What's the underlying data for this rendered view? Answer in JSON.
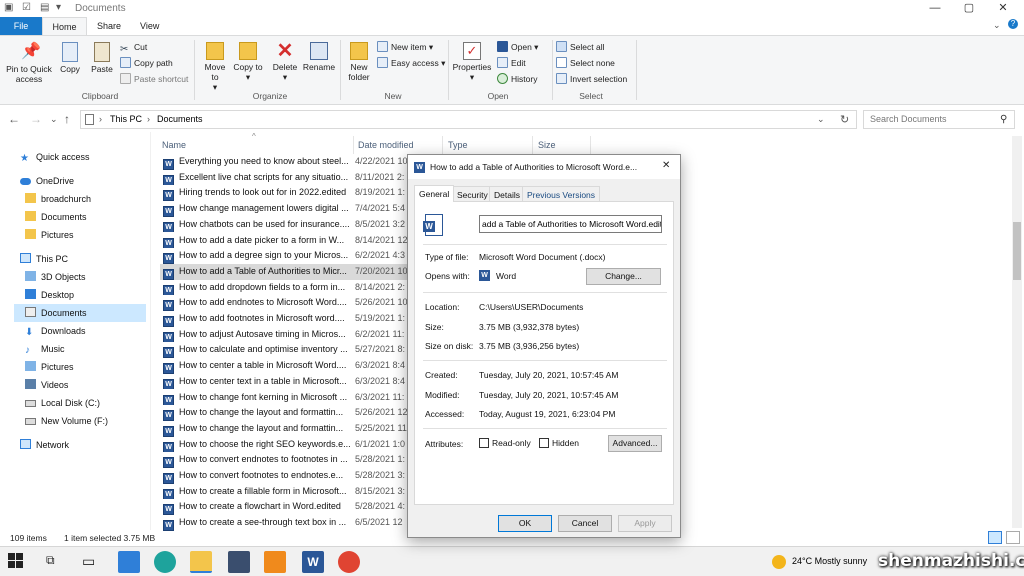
{
  "window": {
    "title": "Documents",
    "controls": {
      "minimize": "—",
      "maximize": "▢",
      "close": "✕"
    }
  },
  "ribbon": {
    "tabs": {
      "file": "File",
      "home": "Home",
      "share": "Share",
      "view": "View"
    },
    "clipboard": {
      "pin": "Pin to Quick access",
      "copy": "Copy",
      "paste": "Paste",
      "cut": "Cut",
      "copy_path": "Copy path",
      "paste_shortcut": "Paste shortcut",
      "label": "Clipboard"
    },
    "organize": {
      "move_to": "Move to",
      "copy_to": "Copy to",
      "delete": "Delete",
      "rename": "Rename",
      "label": "Organize"
    },
    "new": {
      "new_folder": "New folder",
      "new_item": "New item",
      "easy_access": "Easy access",
      "label": "New"
    },
    "open": {
      "properties": "Properties",
      "open": "Open",
      "edit": "Edit",
      "history": "History",
      "label": "Open"
    },
    "select": {
      "select_all": "Select all",
      "select_none": "Select none",
      "invert": "Invert selection",
      "label": "Select"
    }
  },
  "address": {
    "segments": [
      "This PC",
      "Documents"
    ],
    "search_placeholder": "Search Documents"
  },
  "navpane": {
    "quick_access": "Quick access",
    "onedrive": "OneDrive",
    "onedrive_items": [
      "broadchurch",
      "Documents",
      "Pictures"
    ],
    "this_pc": "This PC",
    "this_pc_items": [
      "3D Objects",
      "Desktop",
      "Documents",
      "Downloads",
      "Music",
      "Pictures",
      "Videos",
      "Local Disk (C:)",
      "New Volume (F:)"
    ],
    "network": "Network"
  },
  "columns": {
    "name": "Name",
    "date": "Date modified",
    "type": "Type",
    "size": "Size"
  },
  "files": [
    {
      "name": "Everything you need to know about steel...",
      "date": "4/22/2021 10"
    },
    {
      "name": "Excellent live chat scripts for any situatio...",
      "date": "8/11/2021 2:"
    },
    {
      "name": "Hiring trends to look out for in 2022.edited",
      "date": "8/19/2021 1:"
    },
    {
      "name": "How change management lowers digital ...",
      "date": "7/4/2021 5:4"
    },
    {
      "name": "How chatbots can be used for insurance....",
      "date": "8/5/2021 3:2"
    },
    {
      "name": "How to add a date picker to a form in W...",
      "date": "8/14/2021 12"
    },
    {
      "name": "How to add a degree sign to your Micros...",
      "date": "6/2/2021 4:3"
    },
    {
      "name": "How to add a Table of Authorities to Micr...",
      "date": "7/20/2021 10"
    },
    {
      "name": "How to add dropdown fields to a form in...",
      "date": "8/14/2021 2:"
    },
    {
      "name": "How to add endnotes to Microsoft Word....",
      "date": "5/26/2021 10"
    },
    {
      "name": "How to add footnotes in Microsoft word....",
      "date": "5/19/2021 1:"
    },
    {
      "name": "How to adjust Autosave timing in Micros...",
      "date": "6/2/2021 11:"
    },
    {
      "name": "How to calculate and optimise inventory ...",
      "date": "5/27/2021 8:"
    },
    {
      "name": "How to center a table in Microsoft Word....",
      "date": "6/3/2021 8:4"
    },
    {
      "name": "How to center text in a table in Microsoft...",
      "date": "6/3/2021 8:4"
    },
    {
      "name": "How to change font kerning in Microsoft ...",
      "date": "6/3/2021 11:"
    },
    {
      "name": "How to change the layout and formattin...",
      "date": "5/26/2021 12"
    },
    {
      "name": "How to change the layout and formattin...",
      "date": "5/25/2021 11"
    },
    {
      "name": "How to choose the right SEO keywords.e...",
      "date": "6/1/2021 1:0"
    },
    {
      "name": "How to convert endnotes to footnotes in ...",
      "date": "5/28/2021 1:"
    },
    {
      "name": "How to convert footnotes to endnotes.e...",
      "date": "5/28/2021 3:"
    },
    {
      "name": "How to create a fillable form in Microsoft...",
      "date": "8/15/2021 3:"
    },
    {
      "name": "How to create a flowchart in Word.edited",
      "date": "5/28/2021 4:"
    },
    {
      "name": "How to create a see-through text box in ...",
      "date": "6/5/2021 12"
    }
  ],
  "status": {
    "count": "109 items",
    "selected": "1 item selected  3.75 MB"
  },
  "dialog": {
    "title": "How to add a Table of Authorities to Microsoft Word.e...",
    "tabs": [
      "General",
      "Security",
      "Details",
      "Previous Versions"
    ],
    "filename": "add a Table of Authorities to Microsoft Word.edited",
    "type_label": "Type of file:",
    "type_value": "Microsoft Word Document (.docx)",
    "opens_label": "Opens with:",
    "opens_value": "Word",
    "change_btn": "Change...",
    "location_label": "Location:",
    "location_value": "C:\\Users\\USER\\Documents",
    "size_label": "Size:",
    "size_value": "3.75 MB (3,932,378 bytes)",
    "disk_label": "Size on disk:",
    "disk_value": "3.75 MB (3,936,256 bytes)",
    "created_label": "Created:",
    "created_value": "Tuesday, July 20, 2021, 10:57:45 AM",
    "modified_label": "Modified:",
    "modified_value": "Tuesday, July 20, 2021, 10:57:45 AM",
    "accessed_label": "Accessed:",
    "accessed_value": "Today, August 19, 2021, 6:23:04 PM",
    "attributes_label": "Attributes:",
    "readonly": "Read-only",
    "hidden": "Hidden",
    "advanced_btn": "Advanced...",
    "ok": "OK",
    "cancel": "Cancel",
    "apply": "Apply"
  },
  "taskbar": {
    "weather": "24°C  Mostly sunny"
  },
  "watermark": "shenmazhishi.com"
}
